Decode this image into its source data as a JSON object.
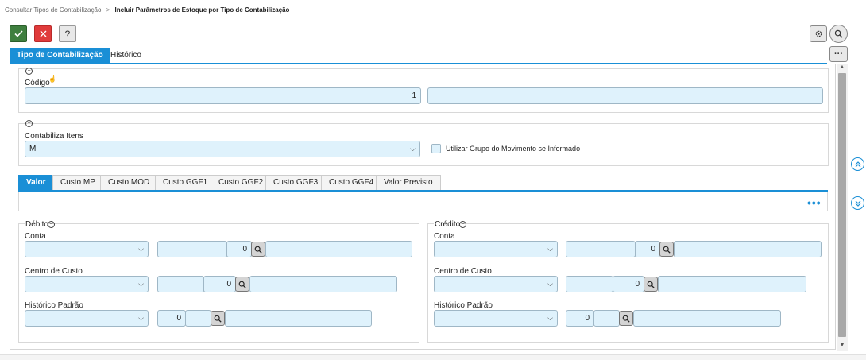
{
  "breadcrumb": {
    "parent": "Consultar Tipos de Contabilização",
    "separator": ">",
    "current": "Incluir Parâmetros de Estoque por Tipo de Contabilização"
  },
  "toolbar": {
    "confirm_icon": "check-icon",
    "cancel_icon": "close-icon",
    "help_label": "?"
  },
  "header_actions": {
    "settings_icon": "gear-icon",
    "search_icon": "search-icon",
    "more_label": "···"
  },
  "tabs": [
    {
      "label": "Tipo de Contabilização",
      "active": true
    },
    {
      "label": "Histórico",
      "active": false
    }
  ],
  "codigo": {
    "label": "Código",
    "value": "1",
    "description": ""
  },
  "contabiliza": {
    "label": "Contabiliza Itens",
    "selected": "M",
    "checkbox_label": "Utilizar Grupo do Movimento se Informado",
    "checkbox_checked": false
  },
  "subtabs": [
    {
      "label": "Valor",
      "active": true
    },
    {
      "label": "Custo MP"
    },
    {
      "label": "Custo MOD"
    },
    {
      "label": "Custo GGF1"
    },
    {
      "label": "Custo GGF2"
    },
    {
      "label": "Custo GGF3"
    },
    {
      "label": "Custo GGF4"
    },
    {
      "label": "Valor Previsto"
    }
  ],
  "subtabs_more": "•••",
  "debito": {
    "title": "Débito",
    "conta": {
      "label": "Conta",
      "value": "0"
    },
    "centro": {
      "label": "Centro de Custo",
      "value": "0"
    },
    "historico": {
      "label": "Histórico Padrão",
      "value": "0"
    }
  },
  "credito": {
    "title": "Crédito",
    "conta": {
      "label": "Conta",
      "value": "0"
    },
    "centro": {
      "label": "Centro de Custo",
      "value": "0"
    },
    "historico": {
      "label": "Histórico Padrão",
      "value": "0"
    }
  },
  "colors": {
    "accent": "#1a8fd6",
    "confirm": "#3f7f3f",
    "cancel": "#e03b3b",
    "field_bg": "#dff2fc"
  }
}
